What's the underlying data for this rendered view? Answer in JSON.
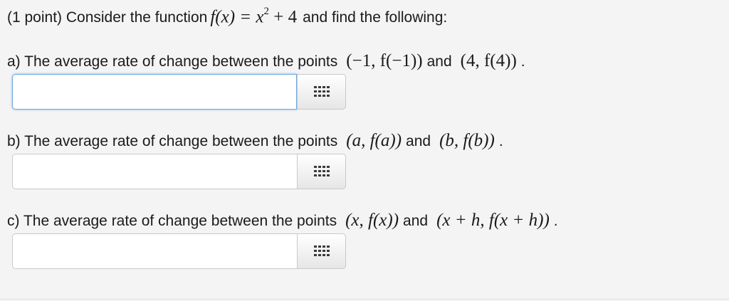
{
  "header": {
    "prefix": "(1 point) Consider the function",
    "fx": "f(x) = x",
    "exponent": "2",
    "rest": "+ 4",
    "suffix": "and find the following:"
  },
  "parts": [
    {
      "label": "a) The average rate of change between the points",
      "p1": "(−1, f(−1))",
      "and": "and",
      "p2": "(4, f(4))",
      "end": "."
    },
    {
      "label": "b) The average rate of change between the points",
      "p1": "(a, f(a))",
      "and": "and",
      "p2": "(b, f(b))",
      "end": "."
    },
    {
      "label": "c) The average rate of change between the points",
      "p1": "(x, f(x))",
      "and": "and",
      "p2": "(x + h, f(x + h))",
      "end": "."
    }
  ],
  "inputs": [
    {
      "value": "",
      "focused": true
    },
    {
      "value": "",
      "focused": false
    },
    {
      "value": "",
      "focused": false
    }
  ],
  "icons": {
    "keypad": "keypad-grid-icon"
  }
}
